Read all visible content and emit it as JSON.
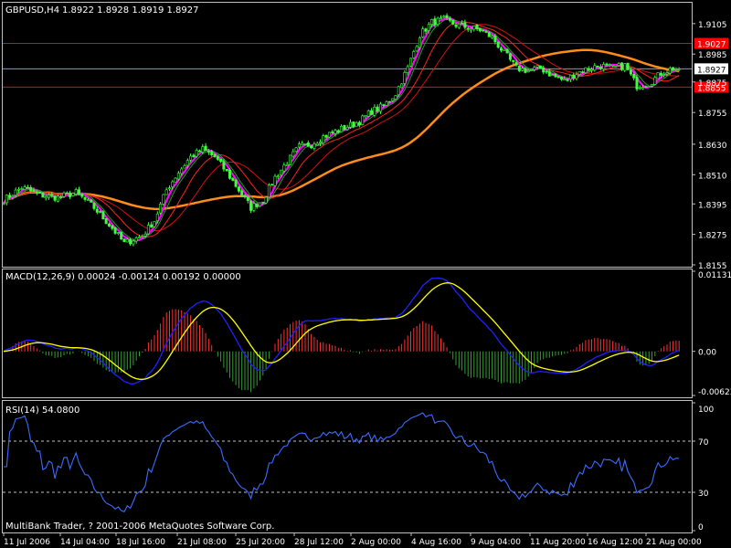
{
  "chart_data": [
    {
      "type": "candlestick",
      "title": "GBPUSD,H4",
      "ohlc_readout": "1.8922 1.8928 1.8919 1.8927",
      "y_ticks": [
        "1.9105",
        "1.8985",
        "1.8875",
        "1.8755",
        "1.8630",
        "1.8510",
        "1.8395",
        "1.8275",
        "1.8155"
      ],
      "ylim": [
        1.8155,
        1.918
      ],
      "current_price_label": "1.8927",
      "current_price": 1.8927,
      "levels": [
        {
          "label": "1.9027",
          "value": 1.9027,
          "color": "#ff0000"
        },
        {
          "label": "1.8855",
          "value": 1.8855,
          "color": "#ff0000"
        }
      ],
      "x_labels": [
        "11 Jul 2006",
        "14 Jul 04:00",
        "18 Jul 16:00",
        "21 Jul 08:00",
        "25 Jul 20:00",
        "28 Jul 12:00",
        "2 Aug 00:00",
        "4 Aug 16:00",
        "9 Aug 04:00",
        "11 Aug 20:00",
        "16 Aug 12:00",
        "21 Aug 00:00"
      ],
      "series_anchors": [
        [
          0,
          1.841
        ],
        [
          6,
          1.846
        ],
        [
          12,
          1.843
        ],
        [
          18,
          1.842
        ],
        [
          24,
          1.844
        ],
        [
          30,
          1.838
        ],
        [
          36,
          1.83
        ],
        [
          40,
          1.824
        ],
        [
          46,
          1.827
        ],
        [
          50,
          1.833
        ],
        [
          54,
          1.845
        ],
        [
          58,
          1.852
        ],
        [
          62,
          1.858
        ],
        [
          66,
          1.861
        ],
        [
          70,
          1.858
        ],
        [
          74,
          1.852
        ],
        [
          78,
          1.845
        ],
        [
          82,
          1.838
        ],
        [
          86,
          1.841
        ],
        [
          90,
          1.85
        ],
        [
          94,
          1.856
        ],
        [
          98,
          1.862
        ],
        [
          102,
          1.863
        ],
        [
          106,
          1.866
        ],
        [
          110,
          1.868
        ],
        [
          114,
          1.87
        ],
        [
          118,
          1.872
        ],
        [
          122,
          1.876
        ],
        [
          126,
          1.878
        ],
        [
          130,
          1.883
        ],
        [
          134,
          1.893
        ],
        [
          138,
          1.906
        ],
        [
          142,
          1.911
        ],
        [
          146,
          1.912
        ],
        [
          150,
          1.91
        ],
        [
          154,
          1.909
        ],
        [
          158,
          1.908
        ],
        [
          162,
          1.905
        ],
        [
          166,
          1.899
        ],
        [
          170,
          1.893
        ],
        [
          174,
          1.892
        ],
        [
          178,
          1.893
        ],
        [
          182,
          1.89
        ],
        [
          186,
          1.888
        ],
        [
          190,
          1.891
        ],
        [
          194,
          1.893
        ],
        [
          198,
          1.894
        ],
        [
          202,
          1.893
        ],
        [
          206,
          1.894
        ],
        [
          210,
          1.886
        ],
        [
          214,
          1.887
        ],
        [
          218,
          1.891
        ],
        [
          222,
          1.893
        ],
        [
          224,
          1.8927
        ]
      ],
      "moving_averages": [
        {
          "color": "#ff8c1a",
          "period": 60
        },
        {
          "color": "#d01010",
          "period": 20
        },
        {
          "color": "#ff2020",
          "period": 12
        },
        {
          "color": "#1ea01e",
          "period": 6
        },
        {
          "color": "#ff00ff",
          "period": 4
        }
      ]
    },
    {
      "type": "macd",
      "title": "MACD(12,26,9) 0.00024 -0.00124 0.00192 0.00000",
      "y_ticks": [
        "0.01131",
        "0.00",
        "-0.00623"
      ],
      "ylim": [
        -0.00623,
        0.01131
      ],
      "series": [
        {
          "name": "MACD",
          "color": "#2020ff"
        },
        {
          "name": "Signal",
          "color": "#ffff00"
        }
      ],
      "histogram_colors": {
        "positive": "#ff3030",
        "negative": "#30a030"
      }
    },
    {
      "type": "line",
      "title": "RSI(14) 54.0800",
      "y_ticks": [
        "100",
        "70",
        "30",
        "0"
      ],
      "ylim": [
        0,
        100
      ],
      "levels": [
        70,
        30
      ],
      "series": [
        {
          "name": "RSI",
          "color": "#3a6cff"
        }
      ]
    }
  ],
  "footer": "MultiBank Trader, ? 2001-2006 MetaQuotes Software Corp."
}
